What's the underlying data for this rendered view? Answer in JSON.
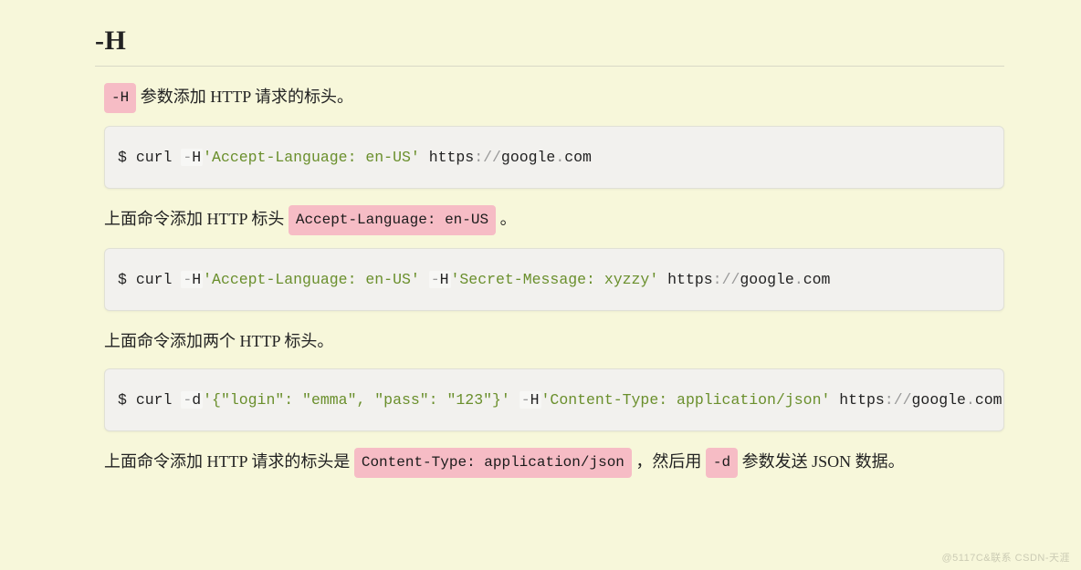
{
  "section": {
    "title": "-H"
  },
  "p1": {
    "code": "-H",
    "text": " 参数添加 HTTP 请求的标头。"
  },
  "code1": {
    "prompt": "$ ",
    "cmd": "curl ",
    "dash1": "-",
    "flag1": "H ",
    "str1": "'Accept-Language: en-US'",
    "sp1": " ",
    "plain1": "https",
    "punct1": "://",
    "plain2": "google",
    "punct2": ".",
    "plain3": "com"
  },
  "p2": {
    "pre": "上面命令添加 HTTP 标头 ",
    "code": "Accept-Language: en-US",
    "post": " 。"
  },
  "code2": {
    "prompt": "$ ",
    "cmd": "curl ",
    "dash1": "-",
    "flag1": "H ",
    "str1": "'Accept-Language: en-US'",
    "sp1": " ",
    "dash2": "-",
    "flag2": "H ",
    "str2": "'Secret-Message: xyzzy'",
    "sp2": " ",
    "plain1": "https",
    "punct1": "://",
    "plain2": "google",
    "punct2": ".",
    "plain3": "com"
  },
  "p3": {
    "text": "上面命令添加两个 HTTP 标头。"
  },
  "code3": {
    "prompt": "$ ",
    "cmd": "curl ",
    "dash1": "-",
    "flag1": "d ",
    "str1": "'{\"login\": \"emma\", \"pass\": \"123\"}'",
    "sp1": " ",
    "dash2": "-",
    "flag2": "H ",
    "str2": "'Content-Type: application/json'",
    "sp2": " ",
    "plain1": "https",
    "punct1": "://",
    "plain2": "google",
    "punct2": ".",
    "plain3": "com"
  },
  "p4": {
    "pre": "上面命令添加 HTTP 请求的标头是 ",
    "code1": "Content-Type: application/json",
    "mid": " ，然后用 ",
    "code2": "-d",
    "post": " 参数发送 JSON 数据。"
  },
  "watermark": "@5117C&联系  CSDN-天涯"
}
